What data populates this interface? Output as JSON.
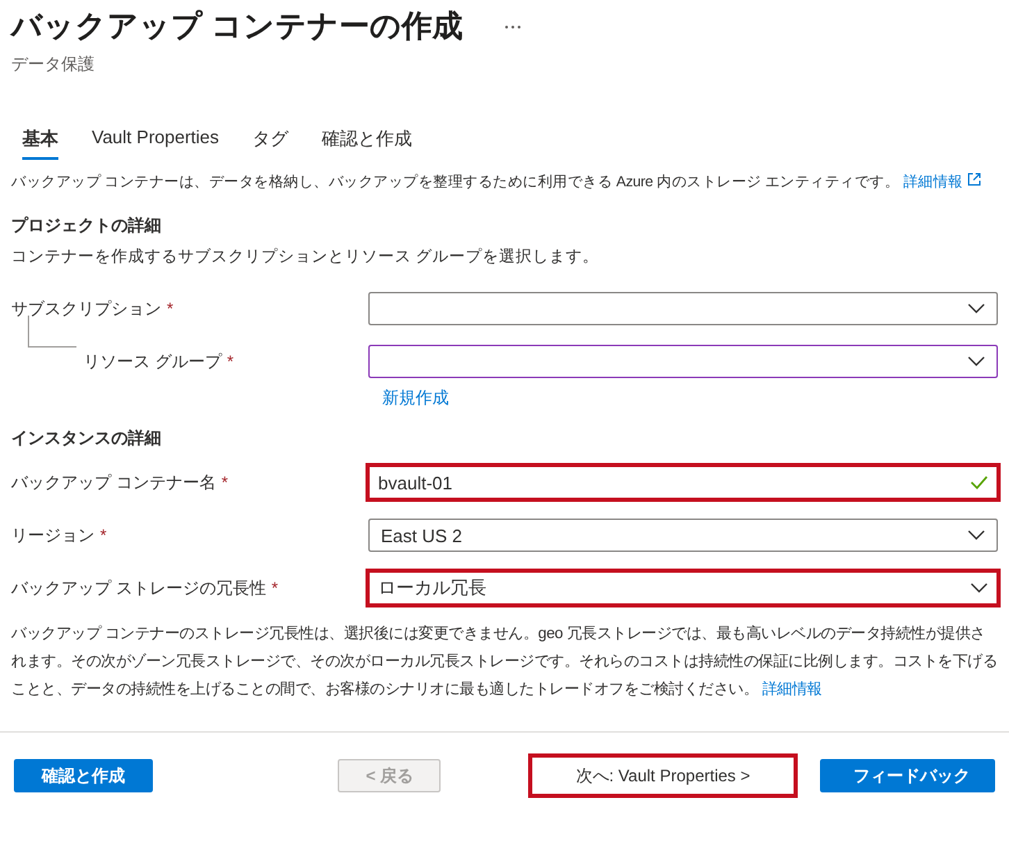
{
  "title": "バックアップ コンテナーの作成",
  "subtitle": "データ保護",
  "tabs": [
    {
      "label": "基本",
      "selected": true
    },
    {
      "label": "Vault Properties",
      "selected": false
    },
    {
      "label": "タグ",
      "selected": false
    },
    {
      "label": "確認と作成",
      "selected": false
    }
  ],
  "intro": {
    "text": "バックアップ コンテナーは、データを格納し、バックアップを整理するために利用できる Azure 内のストレージ エンティティです。",
    "link": "詳細情報"
  },
  "sections": [
    {
      "heading": "プロジェクトの詳細",
      "description": "コンテナーを作成するサブスクリプションとリソース グループを選択します。",
      "fields": [
        {
          "label": "サブスクリプション",
          "mark": "*",
          "kind": "dropdown",
          "focused": false,
          "highlighted": false,
          "children": [
            {
              "label": "リソース グループ",
              "mark": "*",
              "kind": "dropdown",
              "focused": true,
              "highlighted": false,
              "link": "新規作成"
            }
          ]
        }
      ]
    },
    {
      "heading": "インスタンスの詳細",
      "fields": [
        {
          "label": "バックアップ コンテナー名",
          "mark": "*",
          "kind": "text",
          "value": "bvault-01",
          "focused": false,
          "highlighted": true,
          "valid": true
        },
        {
          "label": "リージョン",
          "mark": "*",
          "kind": "dropdown",
          "value": "East US 2",
          "focused": false,
          "highlighted": false
        },
        {
          "label": "バックアップ ストレージの冗長性",
          "mark": "*",
          "kind": "dropdown",
          "value": "ローカル冗長",
          "focused": false,
          "highlighted": true
        }
      ]
    }
  ],
  "note": {
    "text": "バックアップ コンテナーのストレージ冗長性は、選択後には変更できません。geo 冗長ストレージでは、最も高いレベルのデータ持続性が提供されます。その次がゾーン冗長ストレージで、その次がローカル冗長ストレージです。それらのコストは持続性の保証に比例します。コストを下げることと、データの持続性を上げることの間で、お客様のシナリオに最も適したトレードオフをご検討ください。",
    "link": "詳細情報"
  },
  "buttons": [
    {
      "label": "確認と作成",
      "kind": "primary",
      "disabled": false,
      "highlighted": false
    },
    {
      "label": "< 戻る",
      "kind": "secondary",
      "disabled": true,
      "highlighted": false
    },
    {
      "label": "次へ: Vault Properties >",
      "kind": "secondary",
      "disabled": false,
      "highlighted": true
    },
    {
      "label": "フィードバック",
      "kind": "feedback",
      "disabled": false,
      "highlighted": false
    }
  ]
}
